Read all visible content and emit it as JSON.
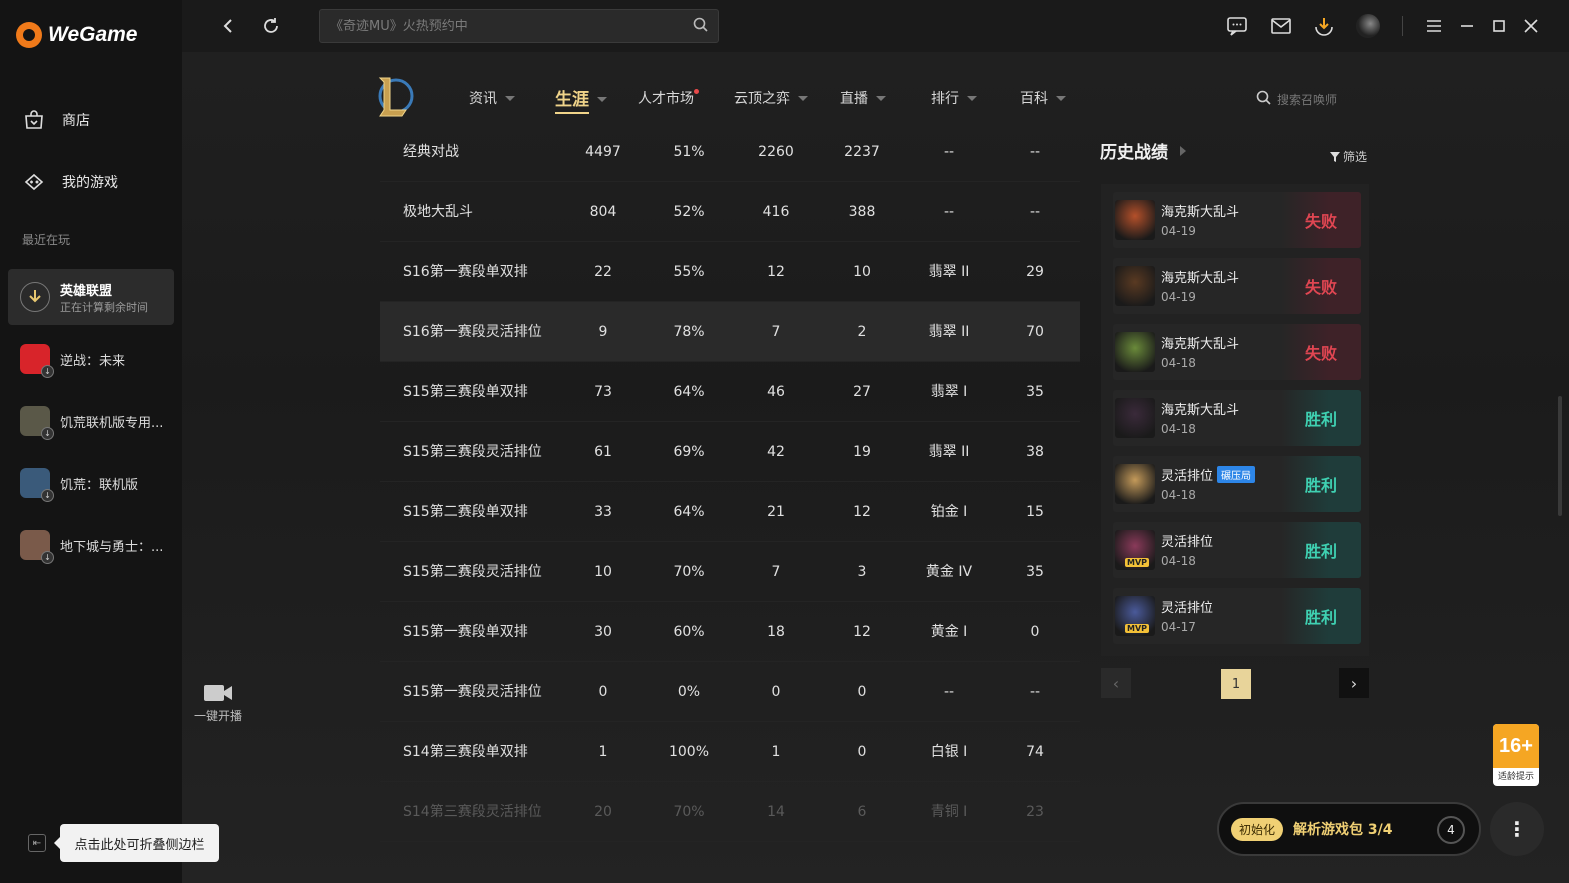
{
  "app": {
    "brand": "WeGame"
  },
  "sidebar": {
    "nav": [
      {
        "label": "商店",
        "icon": "shop-bag-icon"
      },
      {
        "label": "我的游戏",
        "icon": "gamepad-icon"
      }
    ],
    "recent_label": "最近在玩",
    "games": [
      {
        "name": "英雄联盟",
        "sub": "正在计算剩余时间",
        "icon_color": "#2a2a2a"
      },
      {
        "name": "逆战：未来",
        "sub": "",
        "icon_color": "#d8242a"
      },
      {
        "name": "饥荒联机版专用...",
        "sub": "",
        "icon_color": "#5a5848"
      },
      {
        "name": "饥荒：联机版",
        "sub": "",
        "icon_color": "#3a5a7a"
      },
      {
        "name": "地下城与勇士：...",
        "sub": "",
        "icon_color": "#7a5a4a"
      }
    ],
    "tooltip": "点击此处可折叠侧边栏"
  },
  "titlebar": {
    "search_placeholder": "《奇迹MU》火热预约中"
  },
  "lol_nav": {
    "tabs": [
      {
        "label": "资讯"
      },
      {
        "label": "生涯"
      },
      {
        "label": "人才市场"
      },
      {
        "label": "云顶之弈"
      },
      {
        "label": "直播"
      },
      {
        "label": "排行"
      },
      {
        "label": "百科"
      }
    ],
    "search_placeholder": "搜索召唤师"
  },
  "stats_table": {
    "rows": [
      [
        "经典对战",
        "4497",
        "51%",
        "2260",
        "2237",
        "--",
        "--"
      ],
      [
        "极地大乱斗",
        "804",
        "52%",
        "416",
        "388",
        "--",
        "--"
      ],
      [
        "S16第一赛段单双排",
        "22",
        "55%",
        "12",
        "10",
        "翡翠 II",
        "29"
      ],
      [
        "S16第一赛段灵活排位",
        "9",
        "78%",
        "7",
        "2",
        "翡翠 II",
        "70"
      ],
      [
        "S15第三赛段单双排",
        "73",
        "64%",
        "46",
        "27",
        "翡翠 I",
        "35"
      ],
      [
        "S15第三赛段灵活排位",
        "61",
        "69%",
        "42",
        "19",
        "翡翠 II",
        "38"
      ],
      [
        "S15第二赛段单双排",
        "33",
        "64%",
        "21",
        "12",
        "铂金 I",
        "15"
      ],
      [
        "S15第二赛段灵活排位",
        "10",
        "70%",
        "7",
        "3",
        "黄金 IV",
        "35"
      ],
      [
        "S15第一赛段单双排",
        "30",
        "60%",
        "18",
        "12",
        "黄金 I",
        "0"
      ],
      [
        "S15第一赛段灵活排位",
        "0",
        "0%",
        "0",
        "0",
        "--",
        "--"
      ],
      [
        "S14第三赛段单双排",
        "1",
        "100%",
        "1",
        "0",
        "白银 I",
        "74"
      ],
      [
        "S14第三赛段灵活排位",
        "20",
        "70%",
        "14",
        "6",
        "青铜 I",
        "23"
      ]
    ]
  },
  "history": {
    "title": "历史战绩",
    "filter_label": "筛选",
    "matches": [
      {
        "mode": "海克斯大乱斗",
        "date": "04-19",
        "result": "失败",
        "win": false,
        "tag": "",
        "mvp": false,
        "color": "#b4502a"
      },
      {
        "mode": "海克斯大乱斗",
        "date": "04-19",
        "result": "失败",
        "win": false,
        "tag": "",
        "mvp": false,
        "color": "#5a3a22"
      },
      {
        "mode": "海克斯大乱斗",
        "date": "04-18",
        "result": "失败",
        "win": false,
        "tag": "",
        "mvp": false,
        "color": "#6a8a3a"
      },
      {
        "mode": "海克斯大乱斗",
        "date": "04-18",
        "result": "胜利",
        "win": true,
        "tag": "",
        "mvp": false,
        "color": "#3a2a3a"
      },
      {
        "mode": "灵活排位",
        "date": "04-18",
        "result": "胜利",
        "win": true,
        "tag": "碾压局",
        "mvp": false,
        "color": "#c49a5a"
      },
      {
        "mode": "灵活排位",
        "date": "04-18",
        "result": "胜利",
        "win": true,
        "tag": "",
        "mvp": true,
        "color": "#8a3a5a"
      },
      {
        "mode": "灵活排位",
        "date": "04-17",
        "result": "胜利",
        "win": true,
        "tag": "",
        "mvp": true,
        "color": "#4a5a9a"
      }
    ],
    "page": "1"
  },
  "stream": {
    "label": "一键开播"
  },
  "rating": {
    "age": "16+",
    "sub": "适龄提示"
  },
  "download": {
    "init_label": "初始化",
    "text": "解析游戏包 3/4",
    "count": "4"
  }
}
